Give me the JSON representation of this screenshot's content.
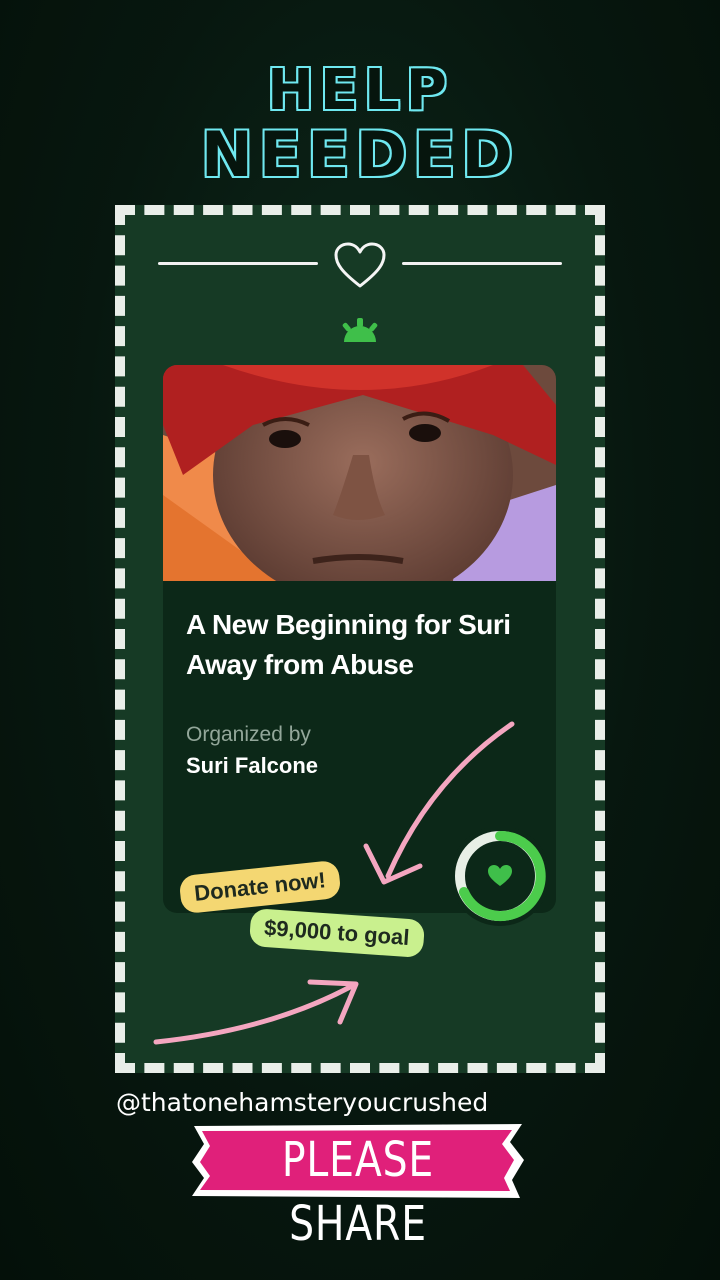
{
  "header": {
    "line1": "HELP",
    "line2": "NEEDED"
  },
  "fundraiser": {
    "title": "A New Beginning for Suri Away from Abuse",
    "organized_label": "Organized by",
    "organizer": "Suri Falcone",
    "donate_label": "Donate now!",
    "goal_label": "$9,000 to goal"
  },
  "footer": {
    "username": "@thatonehamsteryoucrushed",
    "share_label": "PLEASE SHARE"
  },
  "icons": {
    "divider": "heart-outline-icon",
    "brand": "gofundme-logo-icon",
    "progress": "heart-progress-icon"
  },
  "colors": {
    "accent": "#6fe8f0",
    "brand_green": "#3fbf4a",
    "donate_pill": "#f4d772",
    "goal_pill": "#c9f08e",
    "share_banner": "#e0207a"
  }
}
